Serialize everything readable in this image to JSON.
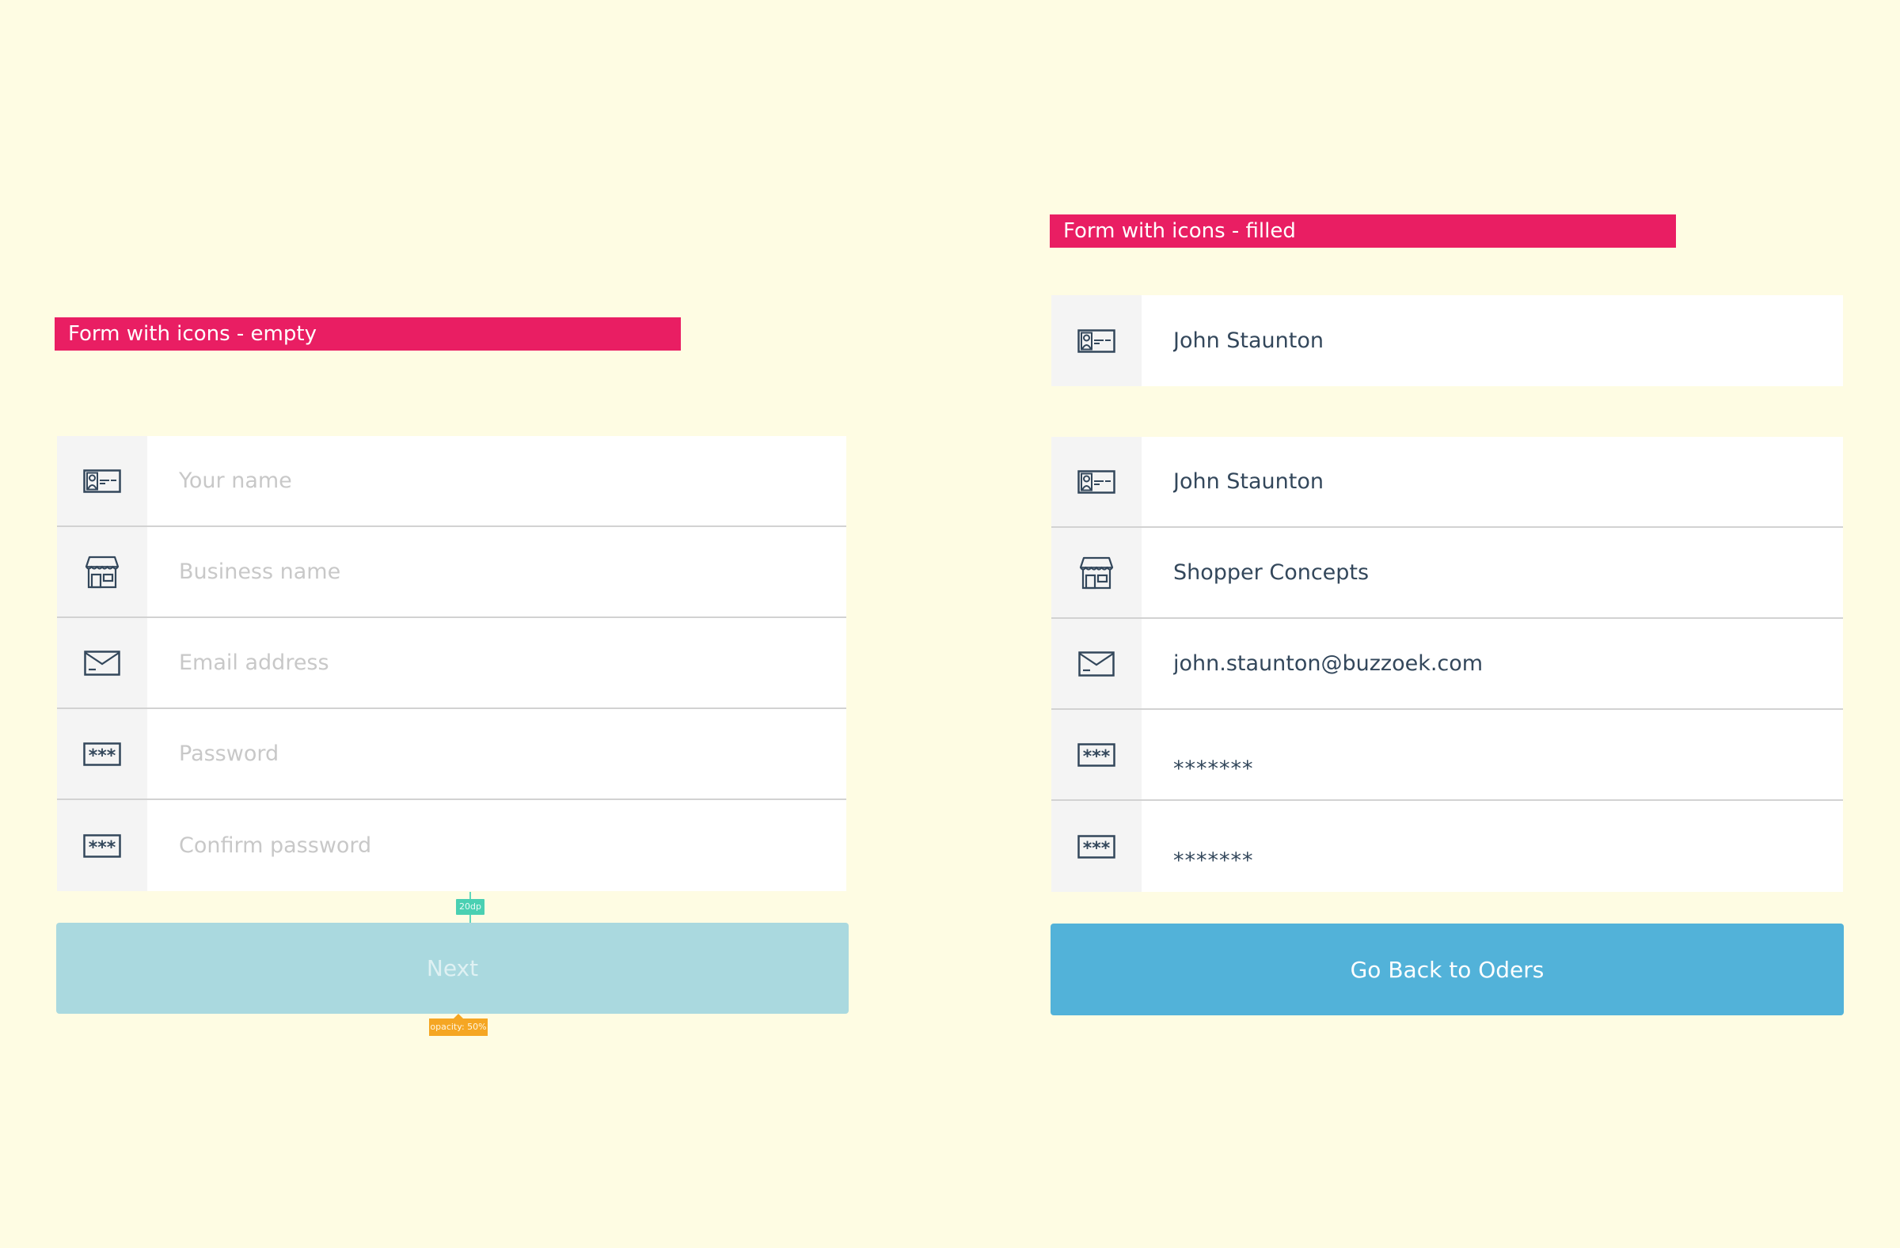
{
  "colors": {
    "background": "#fefce3",
    "banner": "#e91e63",
    "icon_stroke": "#33475b",
    "next_button": "#aad9df",
    "back_button": "#52b2d9",
    "spacing_annotation": "#4ad0b2",
    "opacity_annotation": "#f5a623"
  },
  "empty_form": {
    "banner": "Form with icons - empty",
    "fields": [
      {
        "icon": "id-card-icon",
        "placeholder": "Your name",
        "value": ""
      },
      {
        "icon": "storefront-icon",
        "placeholder": "Business name",
        "value": ""
      },
      {
        "icon": "envelope-icon",
        "placeholder": "Email address",
        "value": ""
      },
      {
        "icon": "password-icon",
        "placeholder": "Password",
        "value": ""
      },
      {
        "icon": "password-icon",
        "placeholder": "Confirm password",
        "value": ""
      }
    ],
    "button_label": "Next",
    "annotations": {
      "spacing": "20dp",
      "opacity": "opacity: 50%"
    }
  },
  "filled_form": {
    "banner": "Form with icons - filled",
    "single_field": {
      "icon": "id-card-icon",
      "value": "John Staunton"
    },
    "fields": [
      {
        "icon": "id-card-icon",
        "value": "John Staunton"
      },
      {
        "icon": "storefront-icon",
        "value": "Shopper Concepts"
      },
      {
        "icon": "envelope-icon",
        "value": "john.staunton@buzzoek.com"
      },
      {
        "icon": "password-icon",
        "value": "*******"
      },
      {
        "icon": "password-icon",
        "value": "*******"
      }
    ],
    "button_label": "Go Back to Oders"
  }
}
